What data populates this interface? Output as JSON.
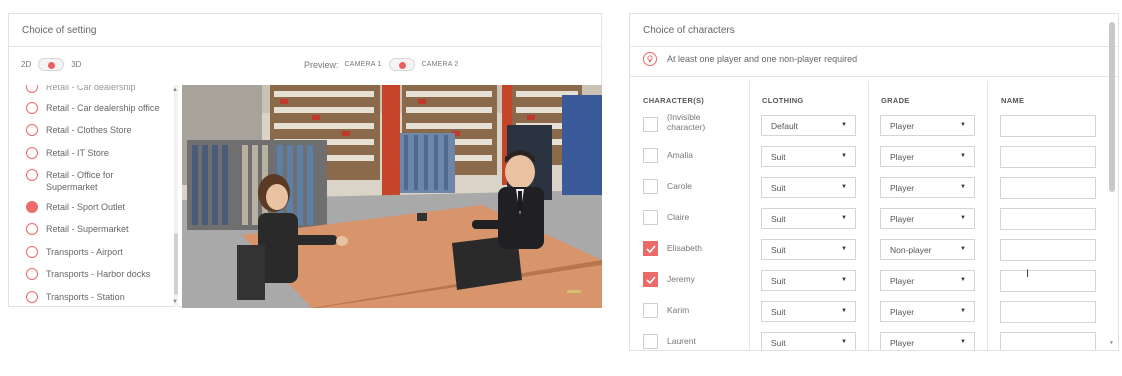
{
  "setting_panel": {
    "title": "Choice of setting",
    "mode_2d": "2D",
    "mode_3d": "3D",
    "preview_label": "Preview:",
    "camera1": "CAMERA 1",
    "camera2": "CAMERA 2",
    "items": [
      {
        "label": "Retail - Car dealership",
        "selected": false
      },
      {
        "label": "Retail - Car dealership office",
        "selected": false
      },
      {
        "label": "Retail - Clothes Store",
        "selected": false
      },
      {
        "label": "Retail - IT Store",
        "selected": false
      },
      {
        "label": "Retail - Office for Supermarket",
        "selected": false
      },
      {
        "label": "Retail - Sport Outlet",
        "selected": true
      },
      {
        "label": "Retail - Supermarket",
        "selected": false
      },
      {
        "label": "Transports - Airport",
        "selected": false
      },
      {
        "label": "Transports - Harbor docks",
        "selected": false
      },
      {
        "label": "Transports - Station",
        "selected": false
      }
    ]
  },
  "characters_panel": {
    "title": "Choice of characters",
    "info": "At least one player and one non-player required",
    "columns": {
      "character": "CHARACTER(S)",
      "clothing": "CLOTHING",
      "grade": "GRADE",
      "name": "NAME"
    },
    "rows": [
      {
        "name": "(Invisible character)",
        "checked": false,
        "clothing": "Default",
        "grade": "Player"
      },
      {
        "name": "Amalia",
        "checked": false,
        "clothing": "Suit",
        "grade": "Player"
      },
      {
        "name": "Carole",
        "checked": false,
        "clothing": "Suit",
        "grade": "Player"
      },
      {
        "name": "Claire",
        "checked": false,
        "clothing": "Suit",
        "grade": "Player"
      },
      {
        "name": "Elisabeth",
        "checked": true,
        "clothing": "Suit",
        "grade": "Non-player"
      },
      {
        "name": "Jeremy",
        "checked": true,
        "clothing": "Suit",
        "grade": "Player"
      },
      {
        "name": "Karim",
        "checked": false,
        "clothing": "Suit",
        "grade": "Player"
      },
      {
        "name": "Laurent",
        "checked": false,
        "clothing": "Suit",
        "grade": "Player"
      }
    ],
    "caret": "▼"
  },
  "colors": {
    "accent": "#ec6a6a",
    "border": "#e2e2e2",
    "text": "#666666"
  },
  "icons": {
    "info": "lightbulb-icon",
    "checkbox": "checkmark-icon",
    "dropdown": "caret-down-icon"
  }
}
